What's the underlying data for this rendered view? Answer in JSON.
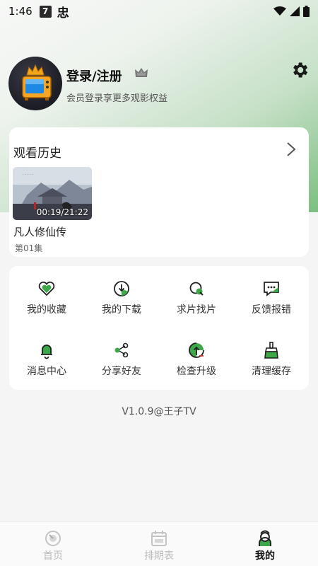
{
  "status_bar": {
    "time": "1:46",
    "app_badge_1": "7",
    "app_badge_2": "忠"
  },
  "profile": {
    "title": "登录/注册",
    "subtitle": "会员登录享更多观影权益"
  },
  "history": {
    "title": "观看历史",
    "items": [
      {
        "title": "凡人修仙传",
        "episode": "第01集",
        "progress": "00:19/21:22"
      }
    ]
  },
  "menu": {
    "items": [
      {
        "label": "我的收藏",
        "icon": "heart-icon"
      },
      {
        "label": "我的下载",
        "icon": "download-icon"
      },
      {
        "label": "求片找片",
        "icon": "search-film-icon"
      },
      {
        "label": "反馈报错",
        "icon": "feedback-icon"
      },
      {
        "label": "消息中心",
        "icon": "bell-icon"
      },
      {
        "label": "分享好友",
        "icon": "share-icon"
      },
      {
        "label": "检查升级",
        "icon": "upgrade-icon"
      },
      {
        "label": "清理缓存",
        "icon": "broom-icon"
      }
    ]
  },
  "version": "V1.0.9@王子TV",
  "bottom_nav": {
    "items": [
      {
        "label": "首页",
        "icon": "home-icon",
        "active": false
      },
      {
        "label": "排期表",
        "icon": "calendar-icon",
        "active": false
      },
      {
        "label": "我的",
        "icon": "profile-icon",
        "active": true
      }
    ]
  },
  "colors": {
    "accent": "#3da84a",
    "gradient_end": "#7cbf80"
  }
}
